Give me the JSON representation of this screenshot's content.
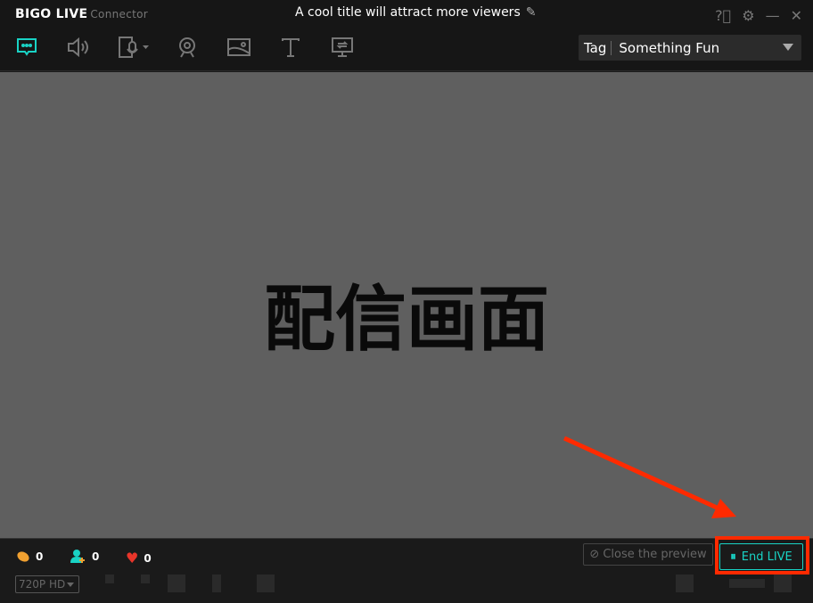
{
  "app": {
    "brand": "BIGO LIVE",
    "sub": "Connector"
  },
  "title": "A cool title will attract more viewers",
  "toolbar": {
    "icons": [
      "chat-icon",
      "speaker-icon",
      "phone-mic-icon",
      "webcam-icon",
      "image-icon",
      "text-icon",
      "screen-share-icon"
    ],
    "active": "chat-icon",
    "accent": "#19d3c5"
  },
  "tag": {
    "label": "Tag",
    "value": "Something Fun"
  },
  "preview": {
    "text": "配信画面"
  },
  "stats": {
    "beans": "0",
    "followers": "0",
    "likes": "0"
  },
  "resolution": "720P HD",
  "buttons": {
    "close_preview": "Close the preview",
    "end_live": "End LIVE"
  },
  "annotation": {
    "color": "#ff2a00"
  }
}
